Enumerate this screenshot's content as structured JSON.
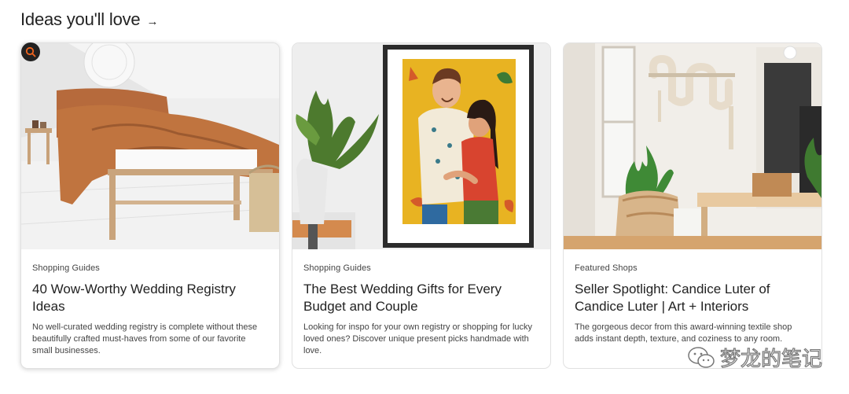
{
  "section": {
    "title": "Ideas you'll love",
    "arrow": "→"
  },
  "cards": [
    {
      "label": "Shopping Guides",
      "title": "40 Wow-Worthy Wedding Registry Ideas",
      "description": "No well-curated wedding registry is complete without these beautifully crafted must-haves from some of our favorite small businesses."
    },
    {
      "label": "Shopping Guides",
      "title": "The Best Wedding Gifts for Every Budget and Couple",
      "description": "Looking for inspo for your own registry or shopping for lucky loved ones? Discover unique present picks handmade with love."
    },
    {
      "label": "Featured Shops",
      "title": "Seller Spotlight: Candice Luter of Candice Luter | Art + Interiors",
      "description": "The gorgeous decor from this award-winning textile shop adds instant depth, texture, and coziness to any room."
    }
  ],
  "watermark": {
    "text": "梦龙的笔记",
    "icon": "wechat-icon"
  },
  "icons": {
    "search_badge": "search-icon",
    "accent": "#f1641e"
  }
}
